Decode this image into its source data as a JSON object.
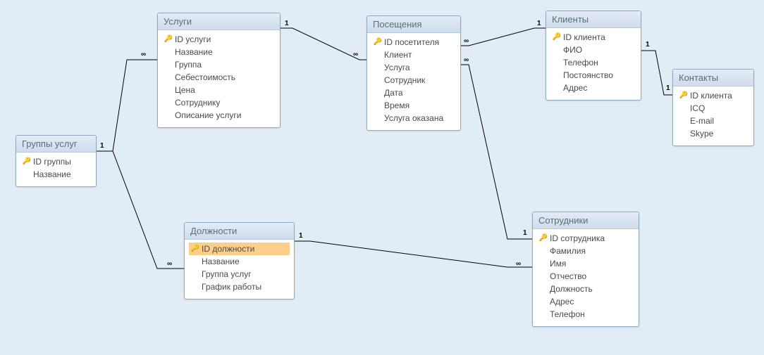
{
  "entities": {
    "groups": {
      "title": "Группы услуг",
      "fields": [
        {
          "name": "ID группы",
          "pk": true
        },
        {
          "name": "Название",
          "pk": false
        }
      ]
    },
    "services": {
      "title": "Услуги",
      "fields": [
        {
          "name": "ID услуги",
          "pk": true
        },
        {
          "name": "Название",
          "pk": false
        },
        {
          "name": "Группа",
          "pk": false
        },
        {
          "name": "Себестоимость",
          "pk": false
        },
        {
          "name": "Цена",
          "pk": false
        },
        {
          "name": "Сотруднику",
          "pk": false
        },
        {
          "name": "Описание услуги",
          "pk": false
        }
      ]
    },
    "visits": {
      "title": "Посещения",
      "fields": [
        {
          "name": "ID посетителя",
          "pk": true
        },
        {
          "name": "Клиент",
          "pk": false
        },
        {
          "name": "Услуга",
          "pk": false
        },
        {
          "name": "Сотрудник",
          "pk": false
        },
        {
          "name": "Дата",
          "pk": false
        },
        {
          "name": "Время",
          "pk": false
        },
        {
          "name": "Услуга оказана",
          "pk": false
        }
      ]
    },
    "clients": {
      "title": "Клиенты",
      "fields": [
        {
          "name": "ID клиента",
          "pk": true
        },
        {
          "name": "ФИО",
          "pk": false
        },
        {
          "name": "Телефон",
          "pk": false
        },
        {
          "name": "Постоянство",
          "pk": false
        },
        {
          "name": "Адрес",
          "pk": false
        }
      ]
    },
    "contacts": {
      "title": "Контакты",
      "fields": [
        {
          "name": "ID клиента",
          "pk": true
        },
        {
          "name": "ICQ",
          "pk": false
        },
        {
          "name": "E-mail",
          "pk": false
        },
        {
          "name": "Skype",
          "pk": false
        }
      ]
    },
    "positions": {
      "title": "Должности",
      "fields": [
        {
          "name": "ID должности",
          "pk": true,
          "selected": true
        },
        {
          "name": "Название",
          "pk": false
        },
        {
          "name": "Группа услуг",
          "pk": false
        },
        {
          "name": "График работы",
          "pk": false
        }
      ]
    },
    "employees": {
      "title": "Сотрудники",
      "fields": [
        {
          "name": "ID сотрудника",
          "pk": true
        },
        {
          "name": "Фамилия",
          "pk": false
        },
        {
          "name": "Имя",
          "pk": false
        },
        {
          "name": "Отчество",
          "pk": false
        },
        {
          "name": "Должность",
          "pk": false
        },
        {
          "name": "Адрес",
          "pk": false
        },
        {
          "name": "Телефон",
          "pk": false
        }
      ]
    }
  },
  "labels": {
    "one": "1",
    "many": "∞"
  }
}
